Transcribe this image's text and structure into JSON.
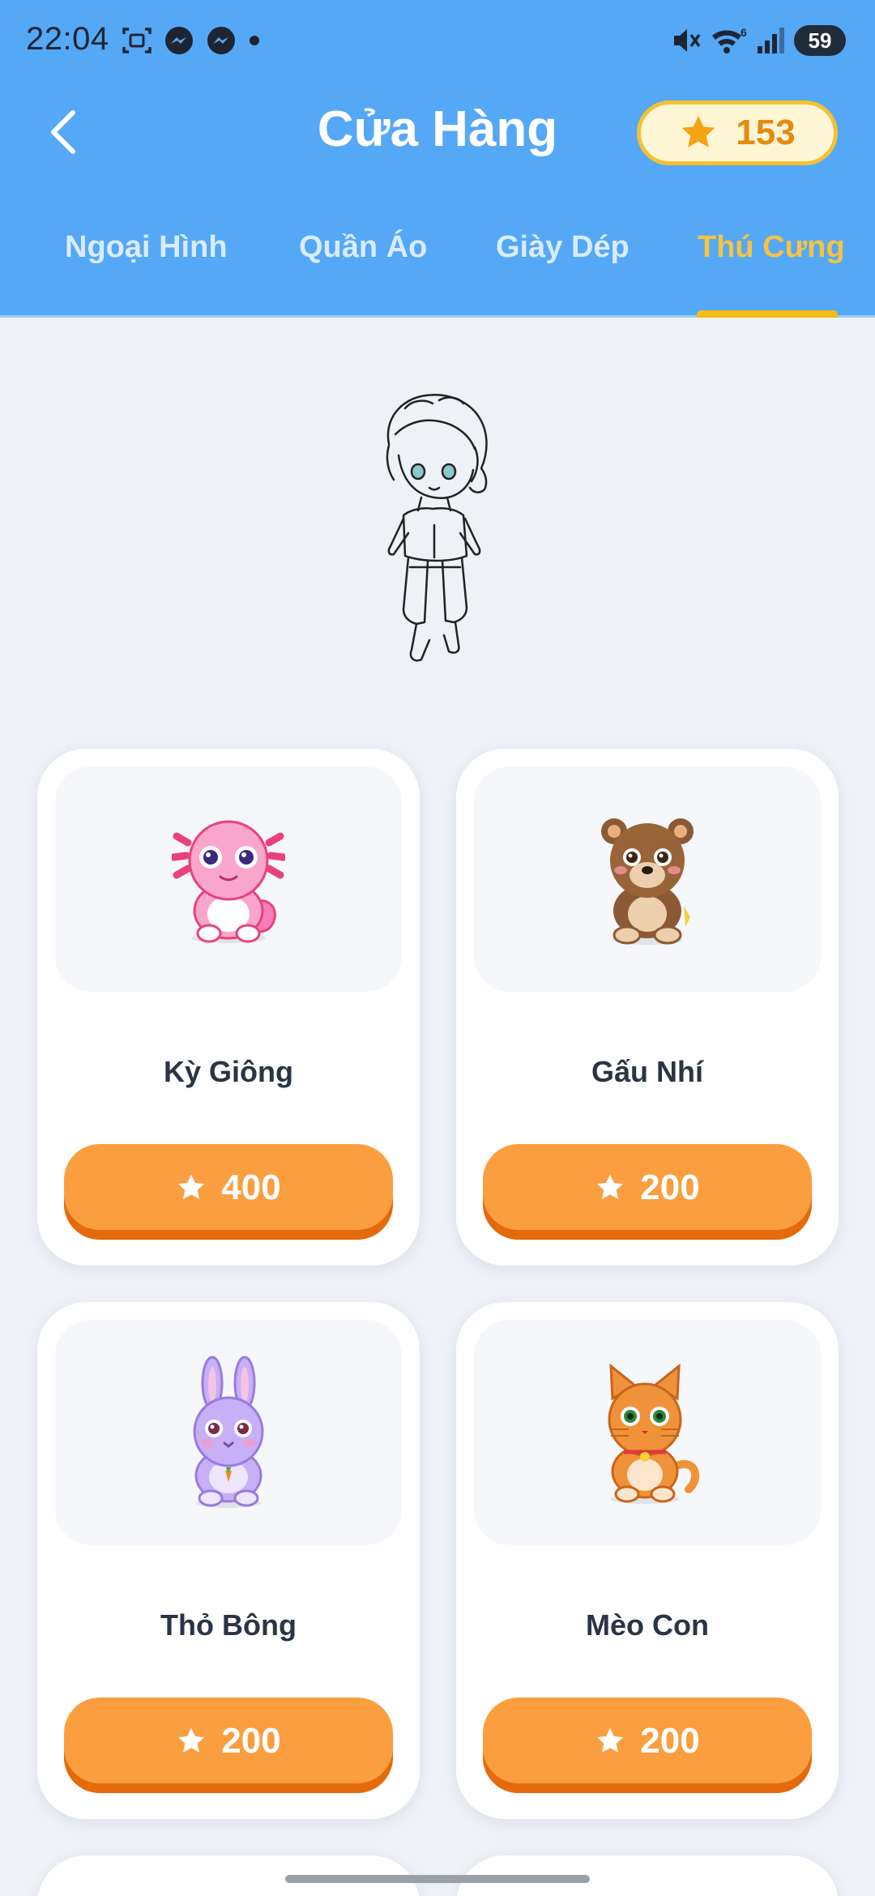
{
  "status_bar": {
    "time": "22:04",
    "left_icons": [
      "screenshot-icon",
      "messenger-icon",
      "messenger-icon",
      "dot-icon"
    ],
    "right_icons": [
      "mute-icon",
      "wifi-icon",
      "signal-icon"
    ],
    "battery": "59"
  },
  "header": {
    "title": "Cửa Hàng",
    "coins": "153"
  },
  "tabs": [
    {
      "label": "Ngoại Hình",
      "active": false
    },
    {
      "label": "Quần Áo",
      "active": false
    },
    {
      "label": "Giày Dép",
      "active": false
    },
    {
      "label": "Thú Cưng",
      "active": true
    }
  ],
  "items": [
    {
      "name": "Kỳ Giông",
      "price": "400",
      "icon": "axolotl-pet-icon",
      "color": "#f47fb6"
    },
    {
      "name": "Gấu Nhí",
      "price": "200",
      "icon": "bear-pet-icon",
      "color": "#8b5a34"
    },
    {
      "name": "Thỏ Bông",
      "price": "200",
      "icon": "bunny-pet-icon",
      "color": "#b89cf0"
    },
    {
      "name": "Mèo Con",
      "price": "200",
      "icon": "cat-pet-icon",
      "color": "#f0923a"
    }
  ],
  "colors": {
    "header_bg": "#55a8f5",
    "active_tab": "#f7c342",
    "buy_button": "#fb9e40",
    "coin_text": "#e58a0e"
  }
}
